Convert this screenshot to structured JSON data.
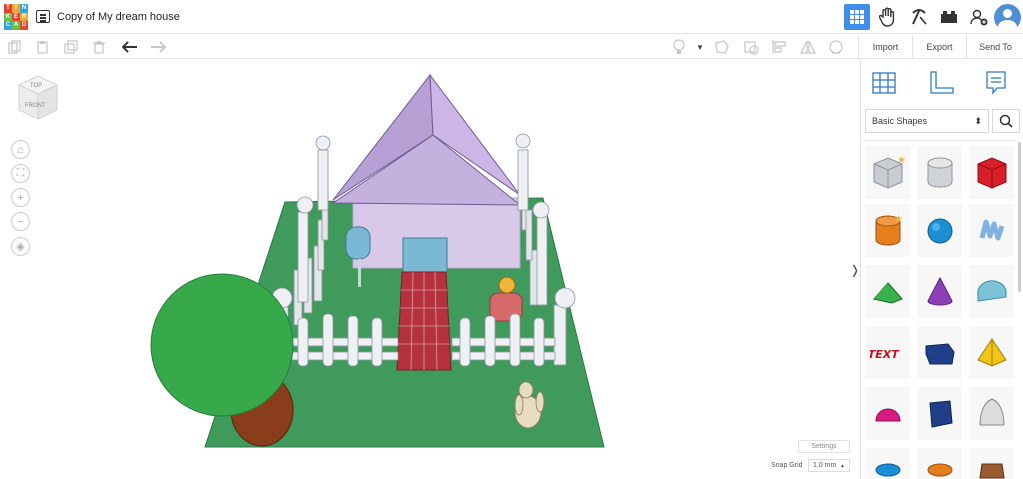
{
  "app": {
    "logo_letters": [
      "T",
      "I",
      "N",
      "K",
      "E",
      "R",
      "C",
      "A",
      "D"
    ],
    "logo_colors": [
      "#e4432d",
      "#f2a53a",
      "#2fa7db",
      "#6cc04a",
      "#e4432d",
      "#f2a53a",
      "#2fa7db",
      "#6cc04a",
      "#e4432d"
    ],
    "title": "Copy of My dream house",
    "accent": "#3f8ee8"
  },
  "header_icons": [
    "grid-view-icon",
    "hand-tinker-icon",
    "pickaxe-icon",
    "bricks-icon",
    "add-user-icon",
    "profile-avatar-icon"
  ],
  "actions": {
    "import": "Import",
    "export": "Export",
    "send_to": "Send To"
  },
  "viewcube": {
    "top": "TOP",
    "front": "FRONT"
  },
  "canvas": {
    "settings": "Settings",
    "snap_grid_label": "Snap Grid",
    "snap_grid_value": "1.0 mm"
  },
  "sidebar": {
    "category": "Basic Shapes",
    "shapes": [
      "box-hole",
      "cylinder-hole",
      "box",
      "cylinder",
      "sphere",
      "scribble",
      "roof",
      "cone",
      "round-roof",
      "text",
      "prism",
      "pyramid",
      "half-sphere",
      "polygon",
      "paraboloid",
      "torus",
      "tube",
      "shape-generator"
    ]
  }
}
